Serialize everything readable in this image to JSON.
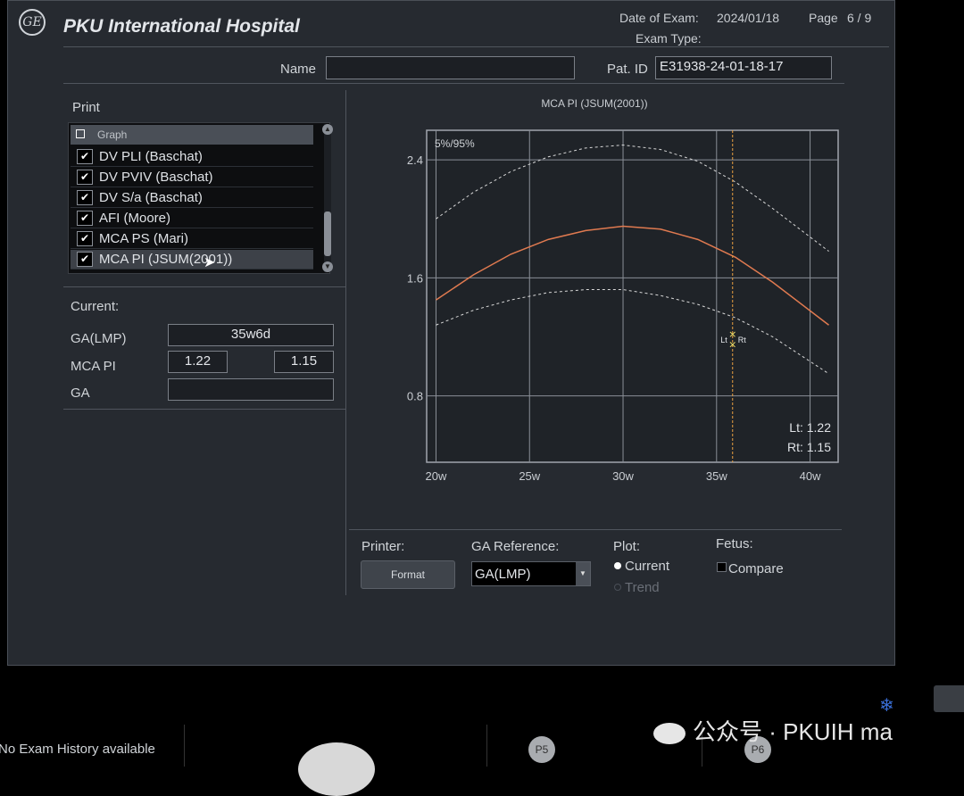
{
  "header": {
    "logo": "GE",
    "hospital": "PKU International Hospital",
    "date_label": "Date of Exam:",
    "date_value": "2024/01/18",
    "page_label": "Page",
    "page_value": "6 / 9",
    "exam_type_label": "Exam Type:",
    "name_label": "Name",
    "name_value": "",
    "patid_label": "Pat. ID",
    "patid_value": "E31938-24-01-18-17"
  },
  "print": {
    "title": "Print",
    "header": "Graph",
    "items": [
      {
        "label": "DV PLI (Baschat)",
        "checked": true
      },
      {
        "label": "DV PVIV (Baschat)",
        "checked": true
      },
      {
        "label": "DV S/a (Baschat)",
        "checked": true
      },
      {
        "label": "AFI (Moore)",
        "checked": true
      },
      {
        "label": "MCA PS (Mari)",
        "checked": true
      },
      {
        "label": "MCA PI (JSUM(2001))",
        "checked": true
      }
    ]
  },
  "current": {
    "title": "Current:",
    "ga_lmp_label": "GA(LMP)",
    "ga_lmp_value": "35w6d",
    "mca_pi_label": "MCA PI",
    "mca_pi_lt": "1.22",
    "mca_pi_rt": "1.15",
    "ga_label": "GA",
    "ga_value": ""
  },
  "chart_data": {
    "type": "line",
    "title": "MCA PI (JSUM(2001))",
    "corner_label": "5%/95%",
    "xlim": [
      19.5,
      41.5
    ],
    "ylim": [
      0.35,
      2.6
    ],
    "x_ticks": [
      20,
      25,
      30,
      35,
      40
    ],
    "x_tick_labels": [
      "20w",
      "25w",
      "30w",
      "35w",
      "40w"
    ],
    "y_ticks": [
      0.8,
      1.6,
      2.4
    ],
    "y_tick_labels": [
      "0.8",
      "1.6",
      "2.4"
    ],
    "grid": true,
    "series": [
      {
        "style": "dashed",
        "color": "#d8d8d8",
        "x": [
          20,
          22,
          24,
          26,
          28,
          30,
          32,
          34,
          36,
          38,
          41
        ],
        "y": [
          2.0,
          2.18,
          2.32,
          2.42,
          2.48,
          2.5,
          2.47,
          2.39,
          2.25,
          2.07,
          1.78
        ]
      },
      {
        "style": "solid",
        "color": "#e07a50",
        "x": [
          20,
          22,
          24,
          26,
          28,
          30,
          32,
          34,
          36,
          38,
          41
        ],
        "y": [
          1.45,
          1.62,
          1.76,
          1.86,
          1.92,
          1.95,
          1.93,
          1.86,
          1.74,
          1.57,
          1.28
        ]
      },
      {
        "style": "dashed",
        "color": "#d8d8d8",
        "x": [
          20,
          22,
          24,
          26,
          28,
          30,
          32,
          34,
          36,
          38,
          41
        ],
        "y": [
          1.28,
          1.38,
          1.45,
          1.5,
          1.52,
          1.52,
          1.48,
          1.42,
          1.33,
          1.2,
          0.95
        ]
      }
    ],
    "cursor_x": 35.857,
    "points": [
      {
        "label": "Lt",
        "x": 35.857,
        "y": 1.22
      },
      {
        "label": "Rt",
        "x": 35.857,
        "y": 1.15
      }
    ],
    "readout": {
      "lt": "Lt: 1.22",
      "rt": "Rt: 1.15"
    },
    "colors": {
      "cursor": "#e8a040",
      "point": "#f2e36a",
      "grid": "#8a8f97"
    }
  },
  "controls": {
    "printer_label": "Printer:",
    "format_button": "Format",
    "ga_ref_label": "GA Reference:",
    "ga_ref_value": "GA(LMP)",
    "plot_label": "Plot:",
    "plot_current": "Current",
    "plot_trend": "Trend",
    "fetus_label": "Fetus:",
    "fetus_compare": "Compare"
  },
  "footer": {
    "history": "No Exam History available",
    "p5": "P5",
    "p6": "P6",
    "watermark": "公众号 · PKUIH ma"
  }
}
